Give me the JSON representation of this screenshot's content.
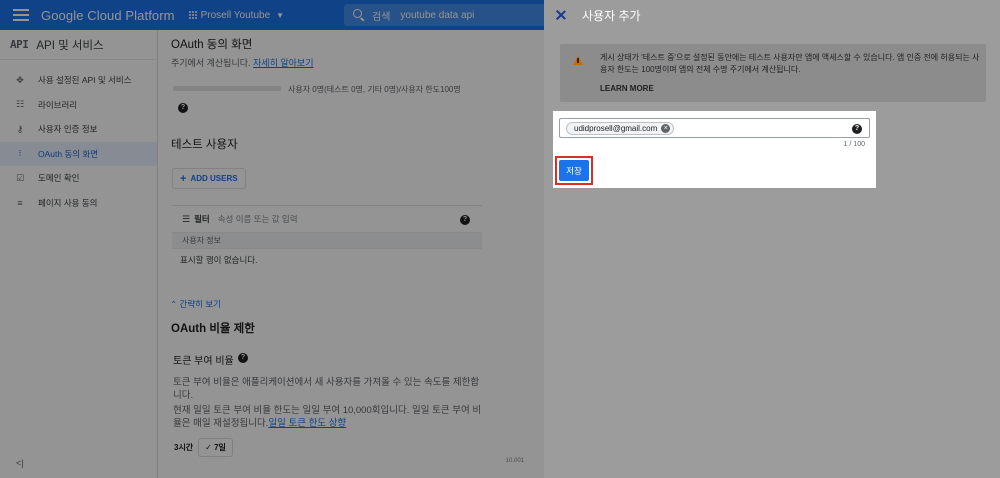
{
  "topbar": {
    "brand": "Google Cloud Platform",
    "project": "Prosell Youtube",
    "search_label": "검색",
    "search_value": "youtube data api"
  },
  "leftnav": {
    "logo": "API",
    "title": "API 및 서비스",
    "items": [
      {
        "label": "사용 설정된 API 및 서비스",
        "icon": "apis-icon",
        "glyph": "✥",
        "active": false
      },
      {
        "label": "라이브러리",
        "icon": "library-icon",
        "glyph": "☷",
        "active": false
      },
      {
        "label": "사용자 인증 정보",
        "icon": "key-icon",
        "glyph": "⚷",
        "active": false
      },
      {
        "label": "OAuth 동의 화면",
        "icon": "consent-icon",
        "glyph": "⁝",
        "active": true
      },
      {
        "label": "도메인 확인",
        "icon": "domain-icon",
        "glyph": "☑",
        "active": false
      },
      {
        "label": "페이지 사용 동의",
        "icon": "settings-icon",
        "glyph": "≡",
        "active": false
      }
    ],
    "collapse": "<|"
  },
  "main": {
    "title": "OAuth 동의 화면",
    "subtitle_text": "주기에서 계산됩니다. ",
    "subtitle_link": "자세히 알아보기",
    "progress_text": "사용자 0명(테스트 0명, 기타 0명)/사용자 한도100명",
    "test_users_title": "테스트 사용자",
    "add_users_label": "ADD USERS",
    "filter_label": "필터",
    "filter_placeholder": "속성 이름 또는 값 입력",
    "column_header": "사용자 정보",
    "empty_text": "표시할 행이 없습니다.",
    "collapse_link": "간략히 보기",
    "rate_title": "OAuth 비율 제한",
    "token_rate_label": "토큰 부여 비율",
    "para1": "토큰 부여 비율은 애플리케이션에서 새 사용자를 가져올 수 있는 속도를 제한합니다.",
    "para2_text": "현재 일일 토큰 부여 비율 한도는 일일 부여 10,000회입니다. 일일 토큰 부여 비율은 매일 재설정됩니다.",
    "para2_link": "일일 토큰 한도 상향",
    "time_opt1": "3시간",
    "time_opt2": "✓ 7일",
    "axis_label": "10,001"
  },
  "panel": {
    "title": "사용자 추가",
    "info_text": "게시 상태가 '테스트 중'으로 설정된 동안에는 테스트 사용자만 앱에 액세스할 수 있습니다. 앱 인증 전에 허용되는 사용자 한도는 100명이며 앱의 전체 수명 주기에서 계산됩니다.",
    "learn_more": "LEARN MORE",
    "chip_email": "udidprosell@gmail.com",
    "counter": "1 / 100",
    "save_label": "저장"
  },
  "colors": {
    "accent": "#1a73e8",
    "highlight_border": "#d93025",
    "warning": "#c76b00"
  }
}
